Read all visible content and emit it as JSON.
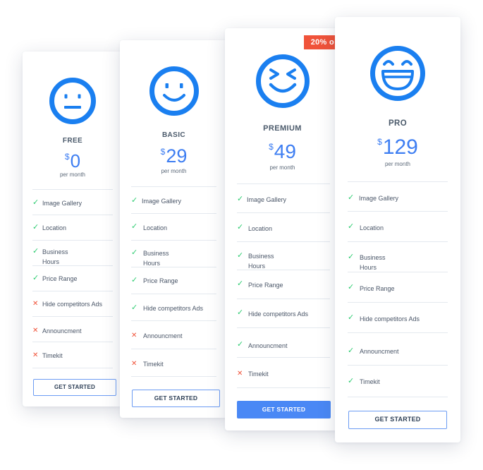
{
  "plans": [
    {
      "name": "FREE",
      "currency": "$",
      "price": "0",
      "period": "per month",
      "icon": "neutral-face-icon",
      "features": [
        {
          "label": "Image Gallery",
          "included": true
        },
        {
          "label": "Location",
          "included": true
        },
        {
          "label": "Business Hours",
          "included": true
        },
        {
          "label": "Price Range",
          "included": true
        },
        {
          "label": "Hide competitors Ads",
          "included": false
        },
        {
          "label": "Announcment",
          "included": false
        },
        {
          "label": "Timekit",
          "included": false
        }
      ],
      "button": "GET STARTED"
    },
    {
      "name": "BASIC",
      "currency": "$",
      "price": "29",
      "period": "per month",
      "icon": "smiling-face-icon",
      "features": [
        {
          "label": "Image Gallery",
          "included": true
        },
        {
          "label": "Location",
          "included": true
        },
        {
          "label": "Business Hours",
          "included": true
        },
        {
          "label": "Price Range",
          "included": true
        },
        {
          "label": "Hide competitors Ads",
          "included": true
        },
        {
          "label": "Announcment",
          "included": false
        },
        {
          "label": "Timekit",
          "included": false
        }
      ],
      "button": "GET STARTED"
    },
    {
      "name": "PREMIUM",
      "currency": "$",
      "price": "49",
      "period": "per month",
      "icon": "squinting-grin-icon",
      "ribbon": "20% o",
      "features": [
        {
          "label": "Image Gallery",
          "included": true
        },
        {
          "label": "Location",
          "included": true
        },
        {
          "label": "Business Hours",
          "included": true
        },
        {
          "label": "Price Range",
          "included": true
        },
        {
          "label": "Hide competitors Ads",
          "included": true
        },
        {
          "label": "Announcment",
          "included": true
        },
        {
          "label": "Timekit",
          "included": false
        }
      ],
      "button": "GET STARTED"
    },
    {
      "name": "PRO",
      "currency": "$",
      "price": "129",
      "period": "per month",
      "icon": "laughing-face-icon",
      "features": [
        {
          "label": "Image Gallery",
          "included": true
        },
        {
          "label": "Location",
          "included": true
        },
        {
          "label": "Business Hours",
          "included": true
        },
        {
          "label": "Price Range",
          "included": true
        },
        {
          "label": "Hide competitors Ads",
          "included": true
        },
        {
          "label": "Announcment",
          "included": true
        },
        {
          "label": "Timekit",
          "included": true
        }
      ],
      "button": "GET STARTED"
    }
  ],
  "colors": {
    "accent": "#3e7ef2",
    "check": "#2ecc71",
    "cross": "#f0533a",
    "ribbon": "#f0533a",
    "button_filled": "#4a88f5"
  }
}
